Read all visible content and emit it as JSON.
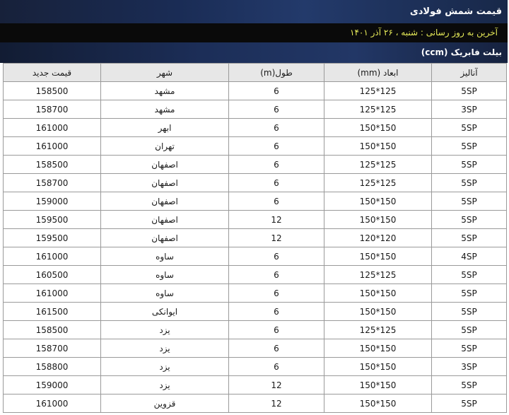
{
  "page": {
    "title": "قیمت شمش فولادی",
    "update_text": "آخرین به روز رسانی : شنبه ، ۲۶ آذر ۱۴۰۱",
    "section_title": "بیلت فابریک (ccm)"
  },
  "table": {
    "headers": [
      "آنالیز",
      "ابعاد (mm)",
      "طول(m)",
      "شهر",
      "قیمت جدید"
    ],
    "rows": [
      [
        "5SP",
        "125*125",
        "6",
        "مشهد",
        "158500"
      ],
      [
        "3SP",
        "125*125",
        "6",
        "مشهد",
        "158700"
      ],
      [
        "5SP",
        "150*150",
        "6",
        "ابهر",
        "161000"
      ],
      [
        "5SP",
        "150*150",
        "6",
        "تهران",
        "161000"
      ],
      [
        "5SP",
        "125*125",
        "6",
        "اصفهان",
        "158500"
      ],
      [
        "5SP",
        "125*125",
        "6",
        "اصفهان",
        "158700"
      ],
      [
        "5SP",
        "150*150",
        "6",
        "اصفهان",
        "159000"
      ],
      [
        "5SP",
        "150*150",
        "12",
        "اصفهان",
        "159500"
      ],
      [
        "5SP",
        "120*120",
        "12",
        "اصفهان",
        "159500"
      ],
      [
        "4SP",
        "150*150",
        "6",
        "ساوه",
        "161000"
      ],
      [
        "5SP",
        "125*125",
        "6",
        "ساوه",
        "160500"
      ],
      [
        "5SP",
        "150*150",
        "6",
        "ساوه",
        "161000"
      ],
      [
        "5SP",
        "150*150",
        "6",
        "ایوانکی",
        "161500"
      ],
      [
        "5SP",
        "125*125",
        "6",
        "یزد",
        "158500"
      ],
      [
        "5SP",
        "150*150",
        "6",
        "یزد",
        "158700"
      ],
      [
        "3SP",
        "150*150",
        "6",
        "یزد",
        "158800"
      ],
      [
        "5SP",
        "150*150",
        "12",
        "یزد",
        "159000"
      ],
      [
        "5SP",
        "150*150",
        "12",
        "قزوین",
        "161000"
      ]
    ]
  }
}
